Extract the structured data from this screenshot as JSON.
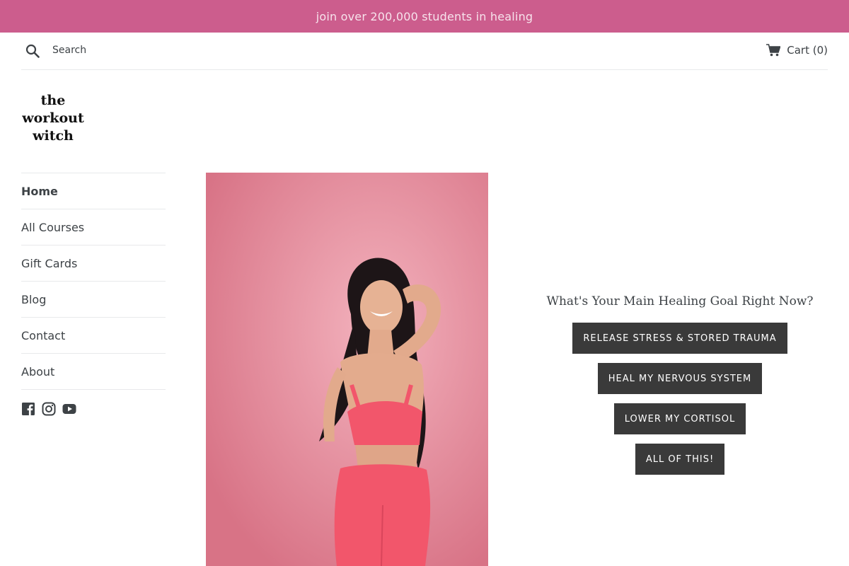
{
  "announcement": "join over 200,000 students in healing",
  "header": {
    "search_placeholder": "Search",
    "cart_label": "Cart (0)"
  },
  "logo": {
    "line1": "the",
    "line2": "workout",
    "line3": "witch"
  },
  "nav": {
    "items": [
      {
        "label": "Home",
        "active": true
      },
      {
        "label": "All Courses"
      },
      {
        "label": "Gift Cards"
      },
      {
        "label": "Blog"
      },
      {
        "label": "Contact"
      },
      {
        "label": "About"
      }
    ]
  },
  "socials": [
    "facebook-icon",
    "instagram-icon",
    "youtube-icon"
  ],
  "cta": {
    "title": "What's Your Main Healing Goal Right Now?",
    "buttons": [
      "RELEASE STRESS & STORED TRAUMA",
      "HEAL MY NERVOUS SYSTEM",
      "LOWER MY CORTISOL",
      "ALL OF THIS!"
    ]
  },
  "colors": {
    "announcement_bg": "#cc5d8d",
    "hero_bg": "#e9909e",
    "button_bg": "#3a3a3a",
    "outfit": "#f2566b"
  }
}
